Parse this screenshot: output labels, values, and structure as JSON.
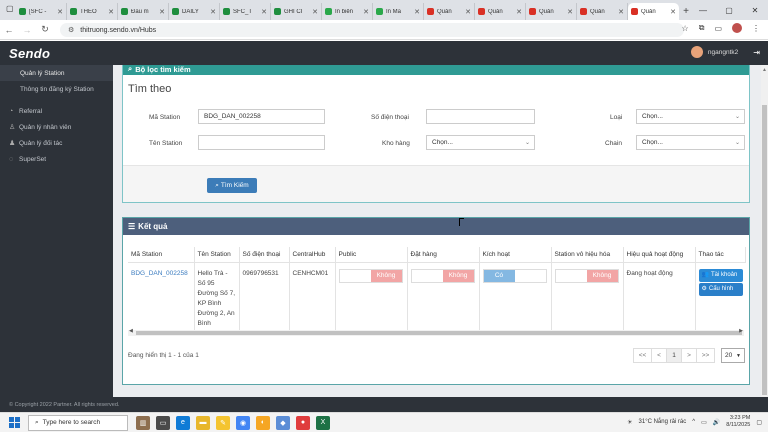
{
  "browser": {
    "tabs": [
      {
        "label": "[SFC -",
        "color": "#1e8e3e"
      },
      {
        "label": "THEO",
        "color": "#1e8e3e"
      },
      {
        "label": "Đầu m",
        "color": "#1e8e3e"
      },
      {
        "label": "DAILY",
        "color": "#1e8e3e"
      },
      {
        "label": "SFC_T",
        "color": "#1e8e3e"
      },
      {
        "label": "GHI CI",
        "color": "#1e8e3e"
      },
      {
        "label": "In biển",
        "color": "#2aa84a"
      },
      {
        "label": "In Mã",
        "color": "#2aa84a"
      },
      {
        "label": "Quản",
        "color": "#d93025"
      },
      {
        "label": "Quản",
        "color": "#d93025"
      },
      {
        "label": "Quản",
        "color": "#d93025"
      },
      {
        "label": "Quản",
        "color": "#d93025"
      },
      {
        "label": "Quản",
        "color": "#d93025"
      }
    ],
    "url": "thitruong.sendo.vn/Hubs"
  },
  "app": {
    "logo": "Sendo",
    "user": "ngangntk2"
  },
  "sidebar": {
    "items": [
      {
        "label": "Quản lý Station",
        "sub": true,
        "selected": true
      },
      {
        "label": "Thông tin đăng ký Station",
        "sub": true,
        "selected": false
      },
      {
        "label": "Referral",
        "sub": false,
        "selected": false
      },
      {
        "label": "Quản lý nhân viên",
        "sub": false,
        "selected": false
      },
      {
        "label": "Quản lý đối tác",
        "sub": false,
        "selected": false
      },
      {
        "label": "SuperSet",
        "sub": false,
        "selected": false
      }
    ]
  },
  "filter": {
    "title": "Bộ lọc tìm kiếm",
    "subtitle": "Tìm theo",
    "ma_station_label": "Mã Station",
    "ma_station_value": "BDG_DAN_002258",
    "ten_station_label": "Tên Station",
    "ten_station_value": "",
    "sdt_label": "Số điện thoại",
    "sdt_value": "",
    "kho_hang_label": "Kho hàng",
    "kho_hang_value": "Chọn...",
    "loai_label": "Loại",
    "loai_value": "Chọn...",
    "chain_label": "Chain",
    "chain_value": "Chọn...",
    "search_button": "Tìm Kiếm"
  },
  "result": {
    "title": "Kết quả",
    "columns": [
      "Mã Station",
      "Tên Station",
      "Số điện thoại",
      "CentralHub",
      "Public",
      "Đặt hàng",
      "Kích hoạt",
      "Station vô hiệu hóa",
      "Hiệu quả hoạt động",
      "Thao tác"
    ],
    "row": {
      "ma_station": "BDG_DAN_002258",
      "ten_station": "Hello Trà - Số 95 Đường Số 7, KP Bình Đường 2, An Bình",
      "sdt": "0969796531",
      "central_hub": "CENHCM01",
      "public": "Không",
      "dat_hang": "Không",
      "kich_hoat": "Có",
      "vo_hieu_hoa": "Không",
      "hieu_qua": "Đang hoạt động",
      "action_account": "Tài khoản",
      "action_config": "Cấu hình"
    },
    "summary": "Đang hiển thị 1 - 1 của 1",
    "pager": [
      "<<",
      "<",
      "1",
      ">",
      ">>"
    ],
    "page_size": "20"
  },
  "footer": "© Copyright 2022 Partner. All rights reserved.",
  "taskbar": {
    "search_placeholder": "Type here to search",
    "weather": "31°C  Nắng rải rác",
    "time": "3:23 PM",
    "date": "8/11/2025"
  }
}
